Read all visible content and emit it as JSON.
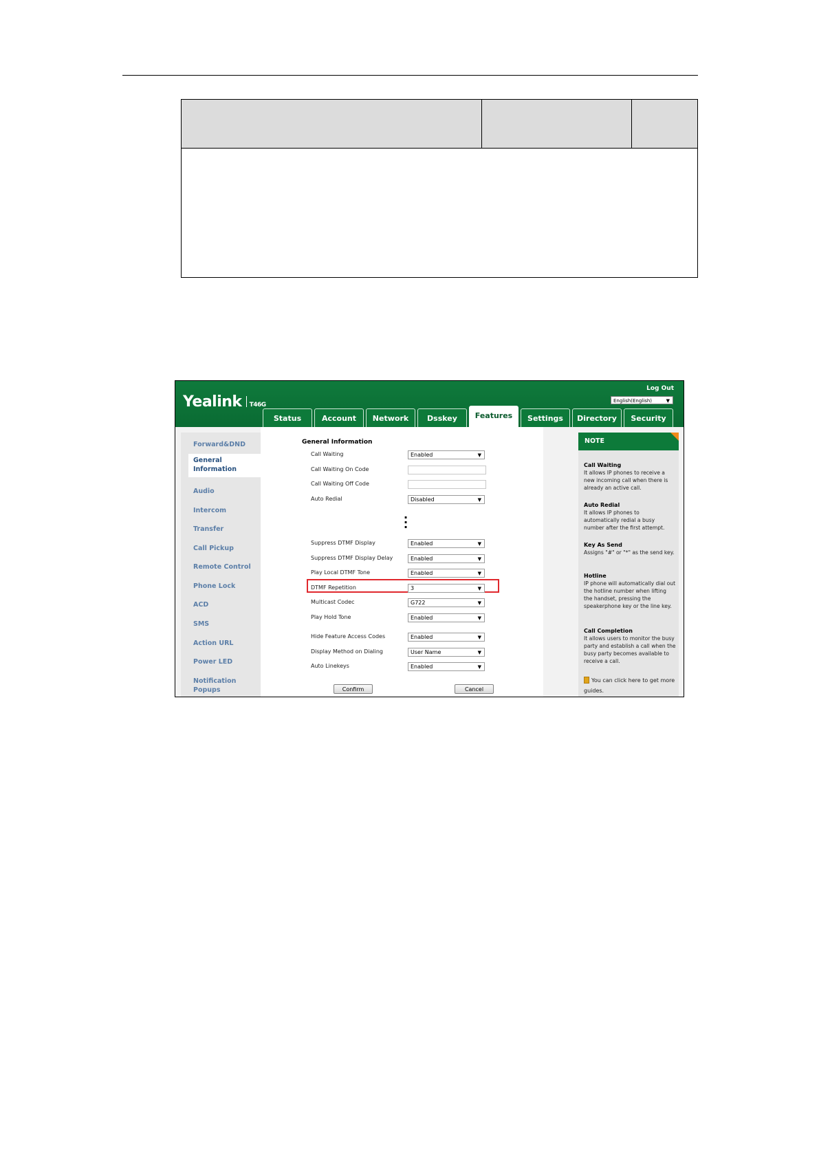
{
  "doc_table": {},
  "screenshot": {
    "brand": {
      "logo_text": "Yealink",
      "model": "T46G"
    },
    "header": {
      "logout": "Log Out",
      "language": "English(English)"
    },
    "tabs": [
      {
        "label": "Status",
        "active": false
      },
      {
        "label": "Account",
        "active": false
      },
      {
        "label": "Network",
        "active": false
      },
      {
        "label": "Dsskey",
        "active": false
      },
      {
        "label": "Features",
        "active": true
      },
      {
        "label": "Settings",
        "active": false
      },
      {
        "label": "Directory",
        "active": false
      },
      {
        "label": "Security",
        "active": false
      }
    ],
    "sidebar": [
      {
        "label": "Forward&DND",
        "active": false
      },
      {
        "label": "General Information",
        "active": true
      },
      {
        "label": "Audio",
        "active": false
      },
      {
        "label": "Intercom",
        "active": false
      },
      {
        "label": "Transfer",
        "active": false
      },
      {
        "label": "Call Pickup",
        "active": false
      },
      {
        "label": "Remote Control",
        "active": false
      },
      {
        "label": "Phone Lock",
        "active": false
      },
      {
        "label": "ACD",
        "active": false
      },
      {
        "label": "SMS",
        "active": false
      },
      {
        "label": "Action URL",
        "active": false
      },
      {
        "label": "Power LED",
        "active": false
      },
      {
        "label": "Notification Popups",
        "active": false
      }
    ],
    "main": {
      "section_title": "General Information",
      "rows": [
        {
          "label": "Call Waiting",
          "type": "select",
          "value": "Enabled"
        },
        {
          "label": "Call Waiting On Code",
          "type": "text",
          "value": ""
        },
        {
          "label": "Call Waiting Off Code",
          "type": "text",
          "value": ""
        },
        {
          "label": "Auto Redial",
          "type": "select",
          "value": "Disabled"
        },
        {
          "label": "Suppress DTMF Display",
          "type": "select",
          "value": "Enabled"
        },
        {
          "label": "Suppress DTMF Display Delay",
          "type": "select",
          "value": "Enabled"
        },
        {
          "label": "Play Local DTMF Tone",
          "type": "select",
          "value": "Enabled",
          "highlighted": true
        },
        {
          "label": "DTMF Repetition",
          "type": "select",
          "value": "3"
        },
        {
          "label": "Multicast Codec",
          "type": "select",
          "value": "G722"
        },
        {
          "label": "Play Hold Tone",
          "type": "select",
          "value": "Enabled"
        },
        {
          "label": "Hide Feature Access Codes",
          "type": "select",
          "value": "Enabled"
        },
        {
          "label": "Display Method on Dialing",
          "type": "select",
          "value": "User Name"
        },
        {
          "label": "Auto Linekeys",
          "type": "select",
          "value": "Enabled"
        }
      ],
      "buttons": {
        "confirm": "Confirm",
        "cancel": "Cancel"
      }
    },
    "note": {
      "title": "NOTE",
      "blocks": [
        {
          "title": "Call Waiting",
          "text": "It allows IP phones to receive a new incoming call when there is already an active call."
        },
        {
          "title": "Auto Redial",
          "text": "It allows IP phones to automatically redial a busy number after the first attempt."
        },
        {
          "title": "Key As Send",
          "text": "Assigns \"#\" or \"*\" as the send key."
        },
        {
          "title": "Hotline",
          "text": "IP phone will automatically dial out the hotline number when lifting the handset, pressing the speakerphone key or the line key."
        },
        {
          "title": "Call Completion",
          "text": "It allows users to monitor the busy party and establish a call when the busy party becomes available to receive a call."
        }
      ],
      "guide_text": "You can click here to get more guides."
    },
    "colors": {
      "header_green": "#0d7a3a",
      "highlight_red": "#e0282d",
      "note_orange": "#f28a1a",
      "nav_link": "#5c7fa8"
    }
  }
}
